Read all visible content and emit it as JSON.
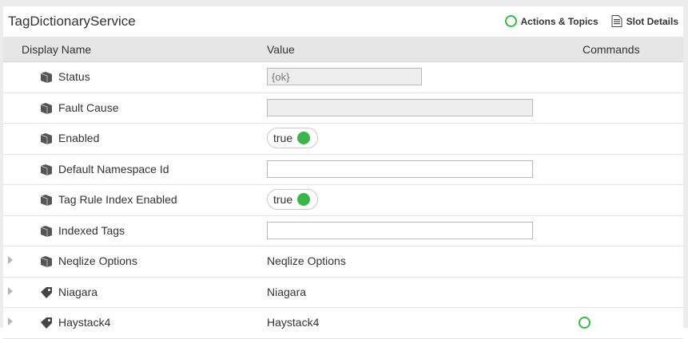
{
  "header": {
    "title": "TagDictionaryService",
    "actions_label": "Actions & Topics",
    "slot_details_label": "Slot Details",
    "accent_color": "#3bb54a"
  },
  "columns": {
    "display_name": "Display Name",
    "value": "Value",
    "commands": "Commands"
  },
  "rows": [
    {
      "label": "Status",
      "icon": "slot-icon",
      "value": "{ok}",
      "kind": "readonly-field"
    },
    {
      "label": "Fault Cause",
      "icon": "slot-icon",
      "value": "",
      "kind": "readonly-field"
    },
    {
      "label": "Enabled",
      "icon": "slot-icon",
      "value": "true",
      "kind": "toggle"
    },
    {
      "label": "Default Namespace Id",
      "icon": "slot-icon",
      "value": "",
      "kind": "input"
    },
    {
      "label": "Tag Rule Index Enabled",
      "icon": "slot-icon",
      "value": "true",
      "kind": "toggle"
    },
    {
      "label": "Indexed Tags",
      "icon": "slot-icon",
      "value": "",
      "kind": "input"
    },
    {
      "label": "Neqlize Options",
      "icon": "slot-icon",
      "value": "Neqlize Options",
      "kind": "text"
    },
    {
      "label": "Niagara",
      "icon": "tag-icon",
      "value": "Niagara",
      "kind": "text"
    },
    {
      "label": "Haystack4",
      "icon": "tag-icon",
      "value": "Haystack4",
      "kind": "text"
    }
  ]
}
